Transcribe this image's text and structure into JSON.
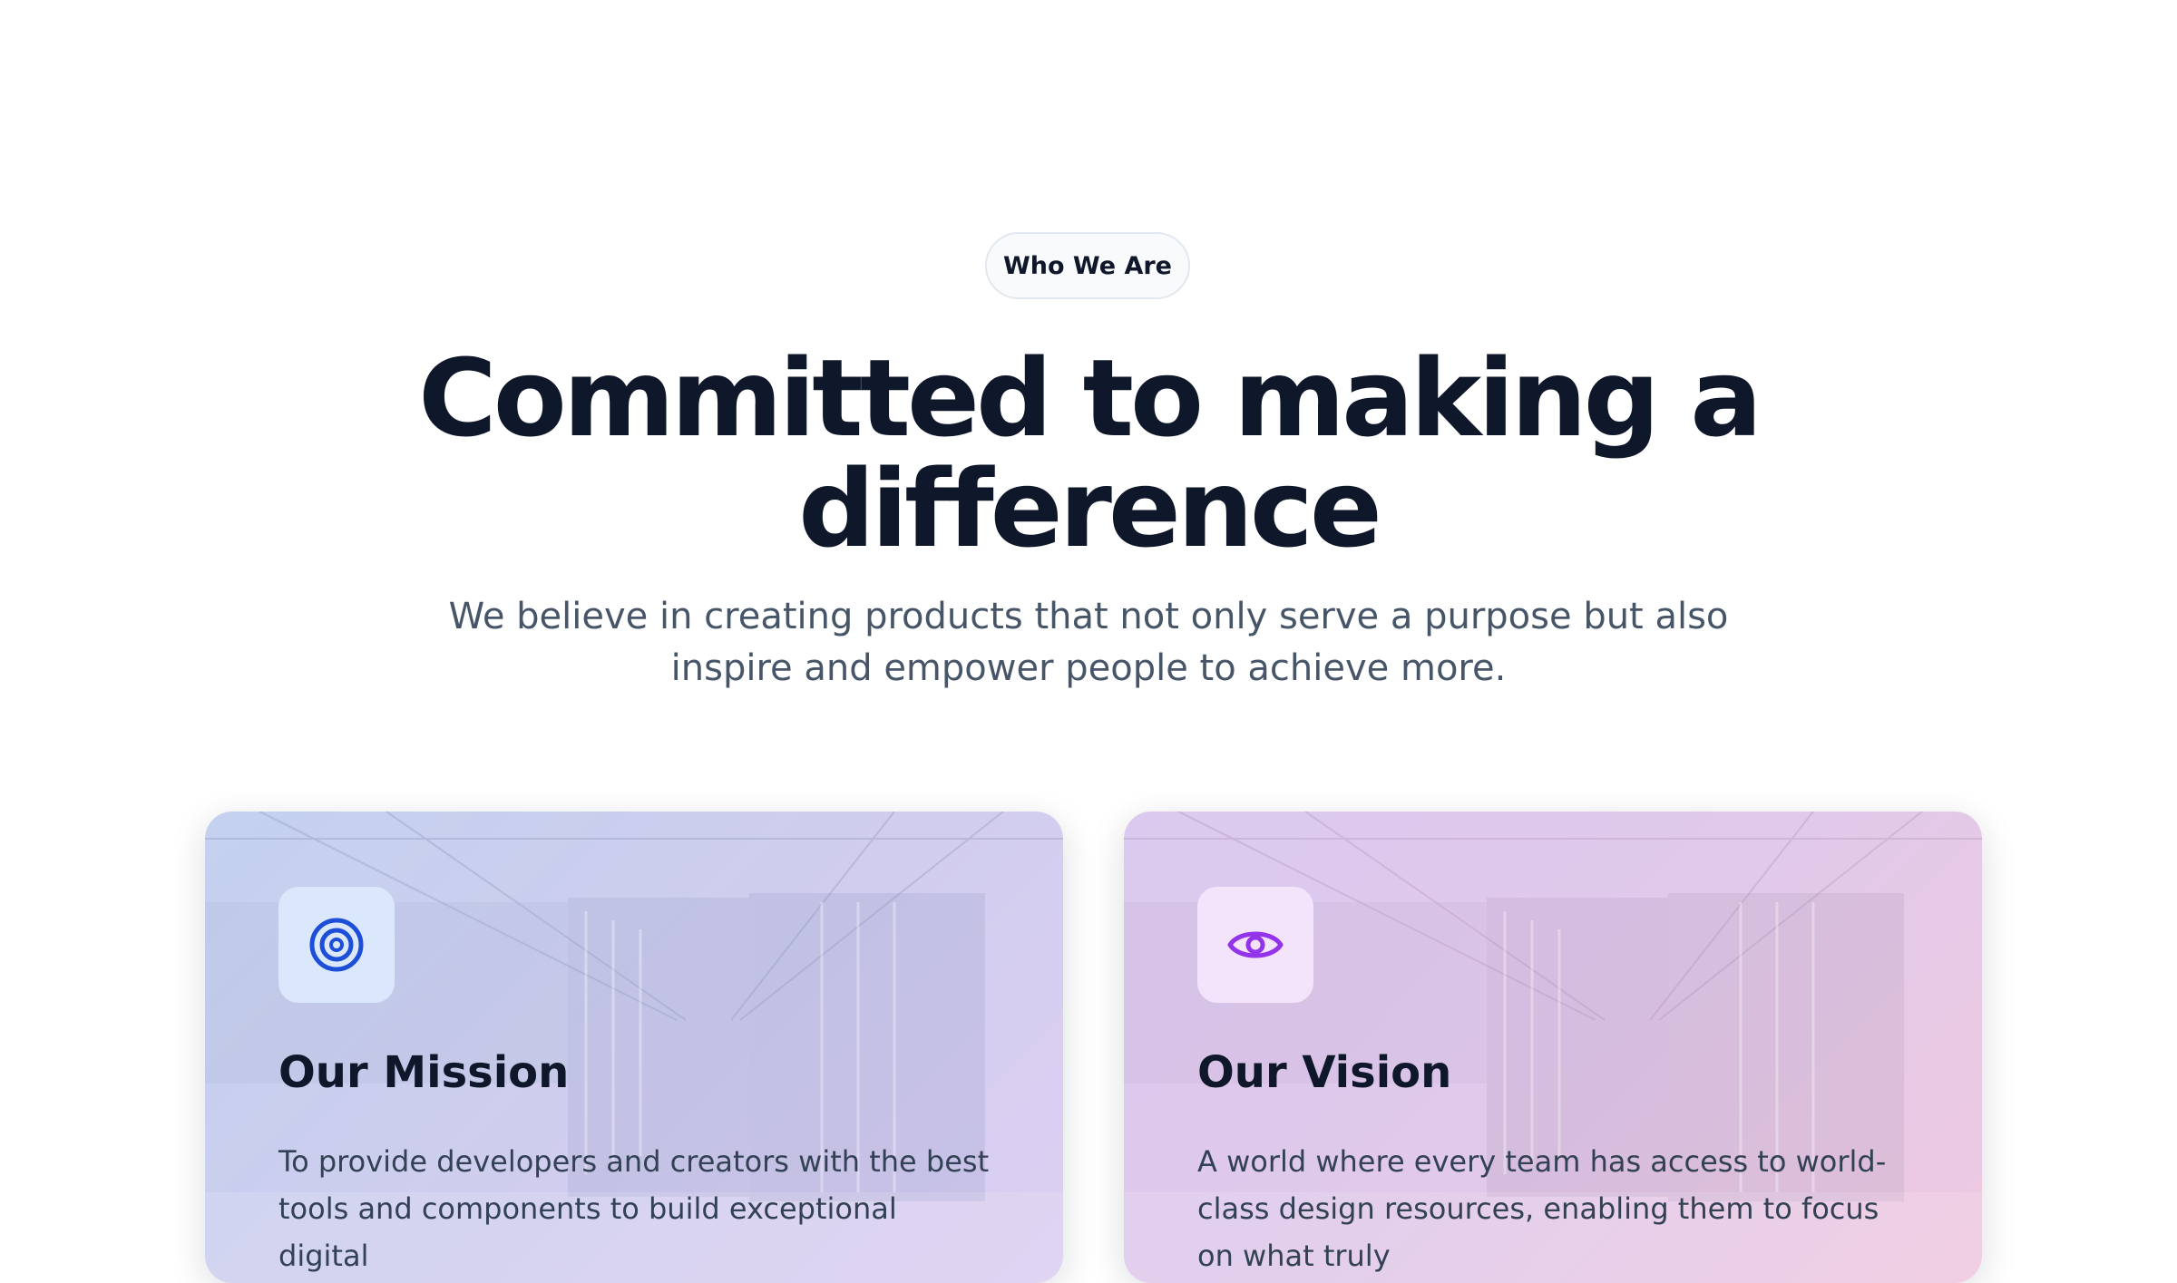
{
  "badge": {
    "label": "Who We Are"
  },
  "hero": {
    "title": "Committed to making a difference",
    "subtitle": "We believe in creating products that not only serve a purpose but also inspire and empower people to achieve more."
  },
  "cards": [
    {
      "title": "Our Mission",
      "text": "To provide developers and creators with the best tools and components to build exceptional digital",
      "icon": "target-icon",
      "accent": "#1d4ed8"
    },
    {
      "title": "Our Vision",
      "text": "A world where every team has access to world-class design resources, enabling them to focus on what truly",
      "icon": "eye-icon",
      "accent": "#9333ea"
    }
  ]
}
